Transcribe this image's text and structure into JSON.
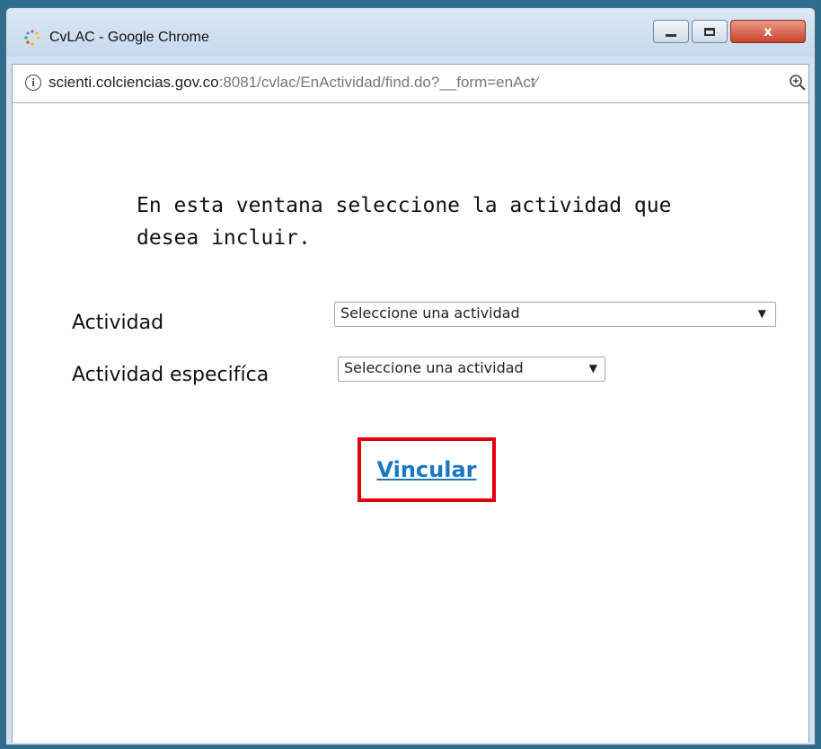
{
  "window": {
    "title": "CvLAC - Google Chrome",
    "close_glyph": "x"
  },
  "address": {
    "host": "scienti.colciencias.gov.co",
    "path": ":8081/cvlac/EnActividad/find.do?__form=enAct⁄"
  },
  "page": {
    "intro": "En esta ventana seleccione la actividad que desea incluir.",
    "actividad_label": "Actividad",
    "actividad_select_value": "Seleccione una actividad",
    "especifica_label": "Actividad especifíca",
    "especifica_select_value": "Seleccione una actividad",
    "link_label": "Vincular"
  },
  "colors": {
    "link": "#1a78c2",
    "highlight_border": "#e2000e"
  }
}
